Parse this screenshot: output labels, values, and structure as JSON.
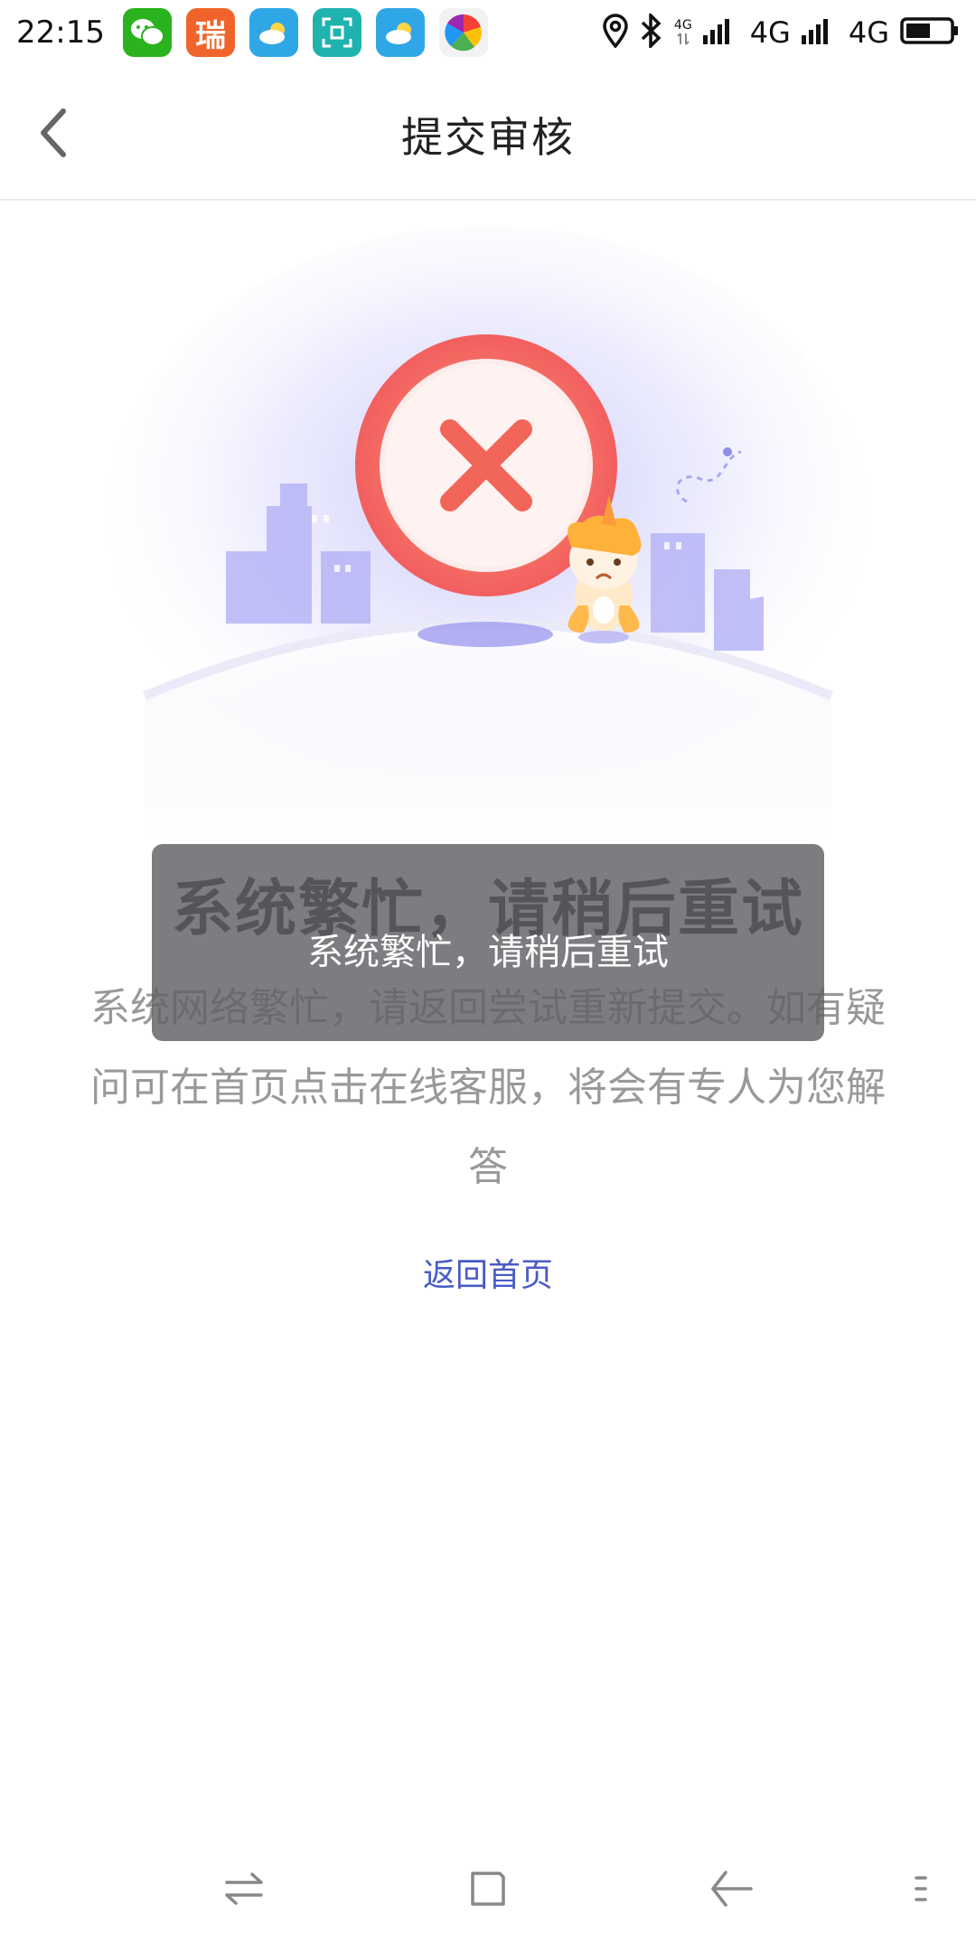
{
  "status_bar": {
    "time": "22:15",
    "apps": [
      {
        "name": "wechat-icon",
        "color": "#2ab31f"
      },
      {
        "name": "rui-icon",
        "label": "瑞",
        "color": "#f0642b"
      },
      {
        "name": "weather-icon",
        "color": "#2fa7e6"
      },
      {
        "name": "scan-icon",
        "color": "#1fb3b0"
      },
      {
        "name": "weather-icon-2",
        "color": "#2fa7e6"
      },
      {
        "name": "colorful-app-icon",
        "color": "#f2f2f2"
      }
    ],
    "network_label_1": "4G",
    "network_label_2": "4G",
    "network_small": "4G"
  },
  "header": {
    "title": "提交审核"
  },
  "main": {
    "error_title": "系统繁忙，请稍后重试",
    "error_description": "系统网络繁忙，请返回尝试重新提交。如有疑问可在首页点击在线客服，将会有专人为您解答",
    "home_link": "返回首页"
  },
  "toast": {
    "message": "系统繁忙，请稍后重试"
  },
  "colors": {
    "accent_link": "#4a5bc5",
    "error_circle": "#f36a5a",
    "illustration_purple": "#b9b8f5"
  }
}
